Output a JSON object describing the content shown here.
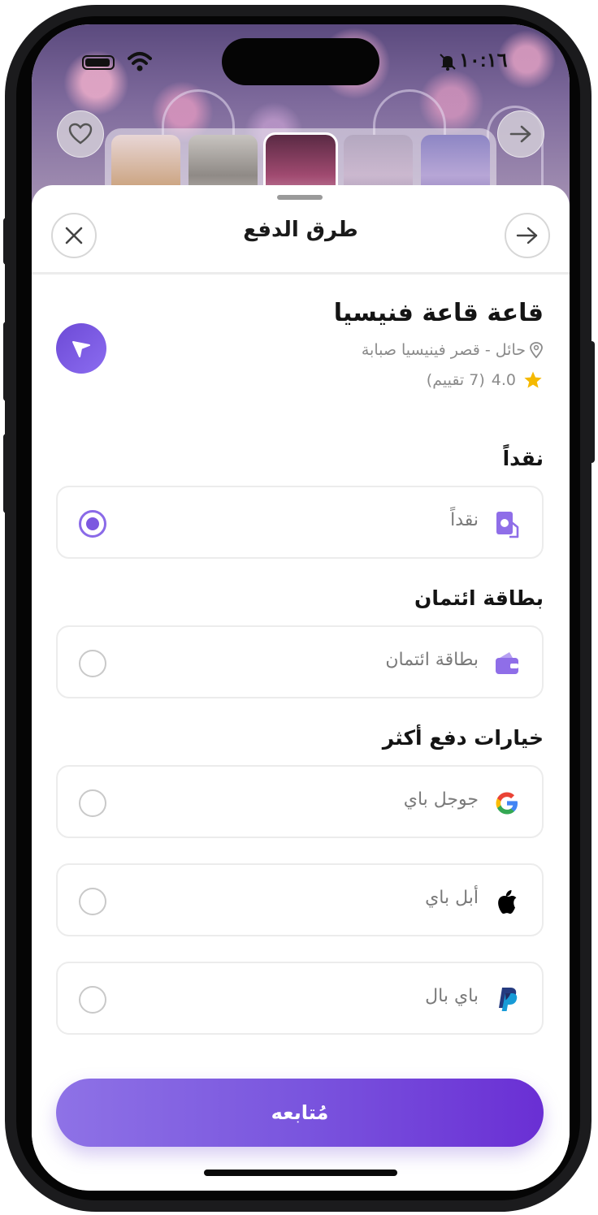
{
  "status_bar": {
    "time": "١٠:١٦"
  },
  "sheet": {
    "title": "طرق الدفع"
  },
  "venue": {
    "name": "قاعة قاعة فنيسيا",
    "location": "حائل - قصر فينيسيا صبابة",
    "rating": "4.0",
    "reviews": "(7 تقييم)"
  },
  "sections": {
    "cash": "نقداً",
    "credit": "بطاقة ائتمان",
    "more": "خيارات دفع أكثر"
  },
  "options": {
    "cash": {
      "label": "نقداً",
      "icon": "cash-icon",
      "selected": true
    },
    "credit": {
      "label": "بطاقة ائتمان",
      "icon": "wallet-icon",
      "selected": false
    },
    "google": {
      "label": "جوجل باي",
      "icon": "google-icon",
      "selected": false
    },
    "apple": {
      "label": "أبل باي",
      "icon": "apple-icon",
      "selected": false
    },
    "paypal": {
      "label": "باي بال",
      "icon": "paypal-icon",
      "selected": false
    }
  },
  "continue_label": "مُتابعه",
  "colors": {
    "accent": "#7c58e0",
    "star": "#f5b900"
  }
}
